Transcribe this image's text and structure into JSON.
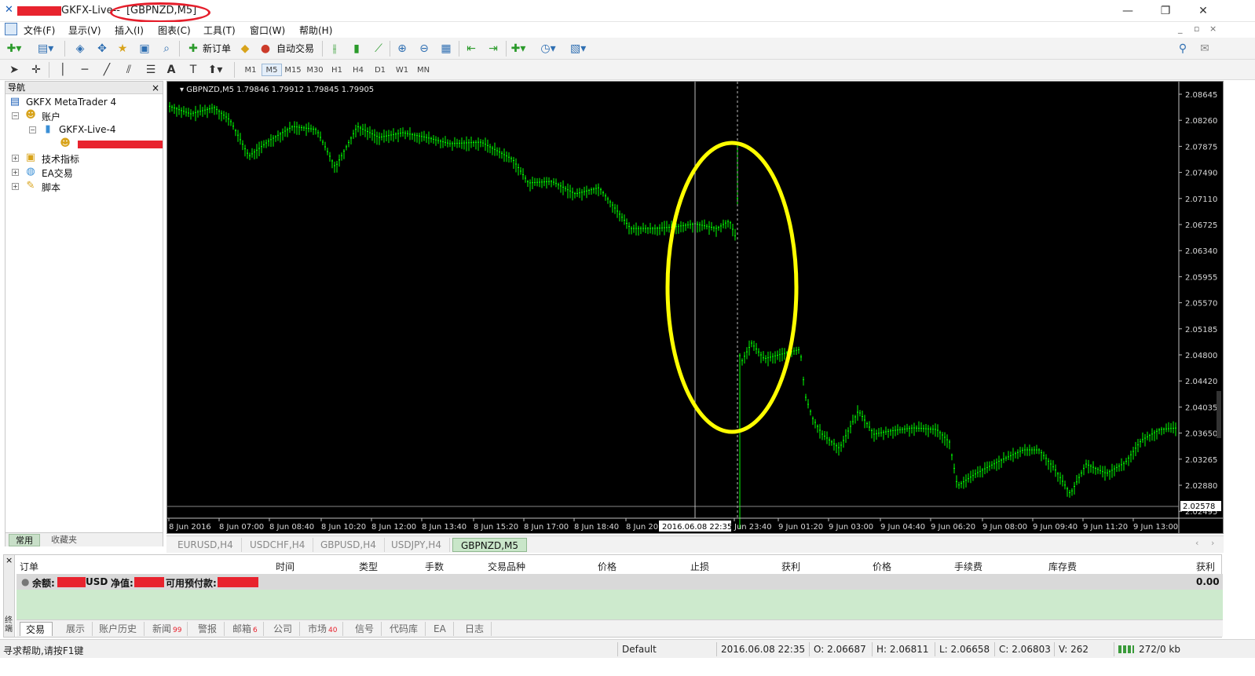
{
  "window": {
    "title_prefix": "GKFX-Live-",
    "title_symbol": "[GBPNZD,M5]",
    "controls": [
      "—",
      "❐",
      "✕"
    ]
  },
  "menu": [
    "文件(F)",
    "显示(V)",
    "插入(I)",
    "图表(C)",
    "工具(T)",
    "窗口(W)",
    "帮助(H)"
  ],
  "toolbar": {
    "new_order": "新订单",
    "auto_trade": "自动交易",
    "timeframes": [
      "M1",
      "M5",
      "M15",
      "M30",
      "H1",
      "H4",
      "D1",
      "W1",
      "MN"
    ],
    "active_timeframe": "M5"
  },
  "navigator": {
    "title": "导航",
    "root": "GKFX MetaTrader 4",
    "accounts": "账户",
    "account_name": "GKFX-Live-4",
    "indicators": "技术指标",
    "experts": "EA交易",
    "scripts": "脚本",
    "tabs": [
      "常用",
      "收藏夹"
    ]
  },
  "chart": {
    "header": "GBPNZD,M5  1.79846 1.79912 1.79845 1.79905",
    "price_labels": [
      "2.08645",
      "2.08260",
      "2.07875",
      "2.07490",
      "2.07110",
      "2.06725",
      "2.06340",
      "2.05955",
      "2.05570",
      "2.05185",
      "2.04800",
      "2.04420",
      "2.04035",
      "2.03650",
      "2.03265",
      "2.02880",
      "2.02495"
    ],
    "current_price": "2.02578",
    "time_labels": [
      "8 Jun 2016",
      "8 Jun 07:00",
      "8 Jun 08:40",
      "8 Jun 10:20",
      "8 Jun 12:00",
      "8 Jun 13:40",
      "8 Jun 15:20",
      "8 Jun 17:00",
      "8 Jun 18:40",
      "8 Jun 20:",
      "2016.06.08 22:35",
      "Jun 23:40",
      "9 Jun 01:20",
      "9 Jun 03:00",
      "9 Jun 04:40",
      "9 Jun 06:20",
      "9 Jun 08:00",
      "9 Jun 09:40",
      "9 Jun 11:20",
      "9 Jun 13:00"
    ],
    "candle_color": "#00ff00",
    "highlight_color": "#ffff00"
  },
  "chart_tabs": [
    "EURUSD,H4",
    "USDCHF,H4",
    "GBPUSD,H4",
    "USDJPY,H4",
    "GBPNZD,M5"
  ],
  "terminal": {
    "columns": [
      "订单",
      "时间",
      "类型",
      "手数",
      "交易品种",
      "价格",
      "止损",
      "获利",
      "价格",
      "手续费",
      "库存费",
      "获利"
    ],
    "balance_label": "余额:",
    "balance_currency": "USD",
    "equity_label": "净值:",
    "free_margin_label": "可用预付款:",
    "profit_total": "0.00",
    "side_label": "终端",
    "tabs": [
      {
        "label": "交易",
        "badge": ""
      },
      {
        "label": "展示",
        "badge": ""
      },
      {
        "label": "账户历史",
        "badge": ""
      },
      {
        "label": "新闻",
        "badge": "99"
      },
      {
        "label": "警报",
        "badge": ""
      },
      {
        "label": "邮箱",
        "badge": "6"
      },
      {
        "label": "公司",
        "badge": ""
      },
      {
        "label": "市场",
        "badge": "40"
      },
      {
        "label": "信号",
        "badge": ""
      },
      {
        "label": "代码库",
        "badge": ""
      },
      {
        "label": "EA",
        "badge": ""
      },
      {
        "label": "日志",
        "badge": ""
      }
    ]
  },
  "status": {
    "help": "寻求帮助,请按F1键",
    "profile": "Default",
    "datetime": "2016.06.08 22:35",
    "open": "O: 2.06687",
    "high": "H: 2.06811",
    "low": "L: 2.06658",
    "close": "C: 2.06803",
    "volume": "V: 262",
    "traffic": "272/0 kb"
  }
}
